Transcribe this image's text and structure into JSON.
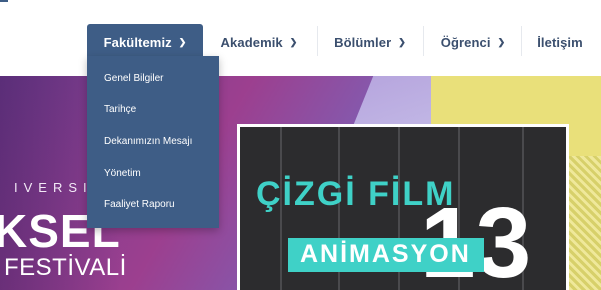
{
  "nav": {
    "items": [
      {
        "label": "Fakültemiz",
        "active": true
      },
      {
        "label": "Akademik",
        "active": false
      },
      {
        "label": "Bölümler",
        "active": false
      },
      {
        "label": "Öğrenci",
        "active": false
      },
      {
        "label": "İletişim",
        "active": false
      }
    ],
    "chevron_icon": "chevron-down-icon",
    "accent_color": "#3e5d86"
  },
  "dropdown": {
    "items": [
      "Genel Bilgiler",
      "Tarihçe",
      "Dekanımızın Mesajı",
      "Yönetim",
      "Faaliyet Raporu"
    ]
  },
  "hero": {
    "university_text": "IVERSIT",
    "event_title": "KSEL",
    "event_subtitle": "FESTİVALİ",
    "poster_title": "ÇİZGİ FİLM",
    "poster_subtitle": "ANİMASYON",
    "poster_number": "13"
  }
}
